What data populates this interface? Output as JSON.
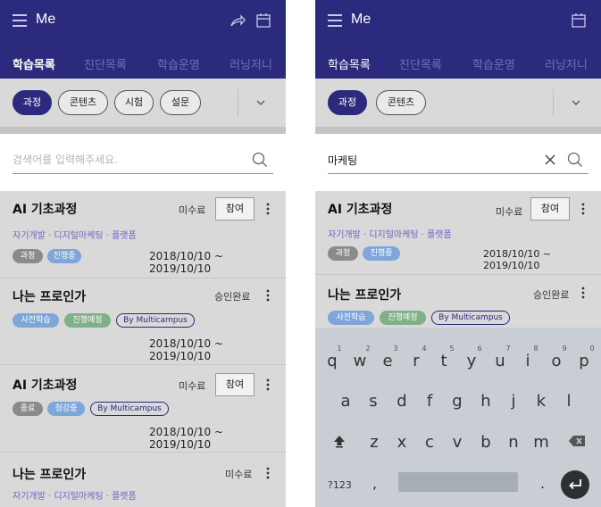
{
  "app": {
    "title": "Me"
  },
  "tabs": [
    "학습목록",
    "진단목록",
    "학습운영",
    "러닝저니"
  ],
  "filters": {
    "left": [
      "과정",
      "콘텐츠",
      "시험",
      "설문"
    ],
    "right": [
      "과정",
      "콘텐츠"
    ]
  },
  "search": {
    "placeholder": "검색어를 입력해주세요.",
    "value": "마케팅"
  },
  "courses_left": [
    {
      "title": "AI 기초과정",
      "status": "미수료",
      "action": "참여",
      "meta": "자기개발 · 디지털마케팅 · 플랫폼",
      "badges": [
        "과정",
        "진행중"
      ],
      "date": "2018/10/10 ~ 2019/10/10"
    },
    {
      "title": "나는 프로인가",
      "status": "승인완료",
      "badges": [
        "사전학습",
        "진행예정",
        "By Multicampus"
      ],
      "date": "2018/10/10 ~ 2019/10/10"
    },
    {
      "title": "AI 기초과정",
      "status": "미수료",
      "action": "참여",
      "badges": [
        "종료",
        "청강중",
        "By Multicampus"
      ],
      "date": "2018/10/10 ~ 2019/10/10"
    },
    {
      "title": "나는 프로인가",
      "status": "미수료",
      "meta": "자기개발 · 디지털마케팅 · 플랫폼"
    }
  ],
  "courses_right": [
    {
      "title": "AI 기초과정",
      "status": "미수료",
      "action": "참여",
      "meta": "자기개발 · 디지털마케팅 · 플랫폼",
      "badges": [
        "과정",
        "진행중"
      ],
      "date": "2018/10/10 ~ 2019/10/10"
    },
    {
      "title": "나는 프로인가",
      "status": "승인완료",
      "badges": [
        "사전학습",
        "진행예정",
        "By Multicampus"
      ]
    }
  ],
  "keyboard": {
    "row1": [
      "q",
      "w",
      "e",
      "r",
      "t",
      "y",
      "u",
      "i",
      "o",
      "p"
    ],
    "row1_hints": [
      "1",
      "2",
      "3",
      "4",
      "5",
      "6",
      "7",
      "8",
      "9",
      "0"
    ],
    "row2": [
      "a",
      "s",
      "d",
      "f",
      "g",
      "h",
      "j",
      "k",
      "l"
    ],
    "row3": [
      "z",
      "x",
      "c",
      "v",
      "b",
      "n",
      "m"
    ],
    "symbols": "?123",
    "comma": ",",
    "period": "."
  },
  "colors": {
    "brand": "#2b2a7c",
    "meta_text": "#6a67c4",
    "badge_blue": "#7ea6d8",
    "badge_green": "#7fb088",
    "badge_gray": "#8a8a8a"
  },
  "icons": [
    "menu-icon",
    "share-icon",
    "calendar-icon",
    "chevron-down-icon",
    "search-icon",
    "clear-icon",
    "more-icon",
    "shift-icon",
    "backspace-icon",
    "enter-icon"
  ]
}
